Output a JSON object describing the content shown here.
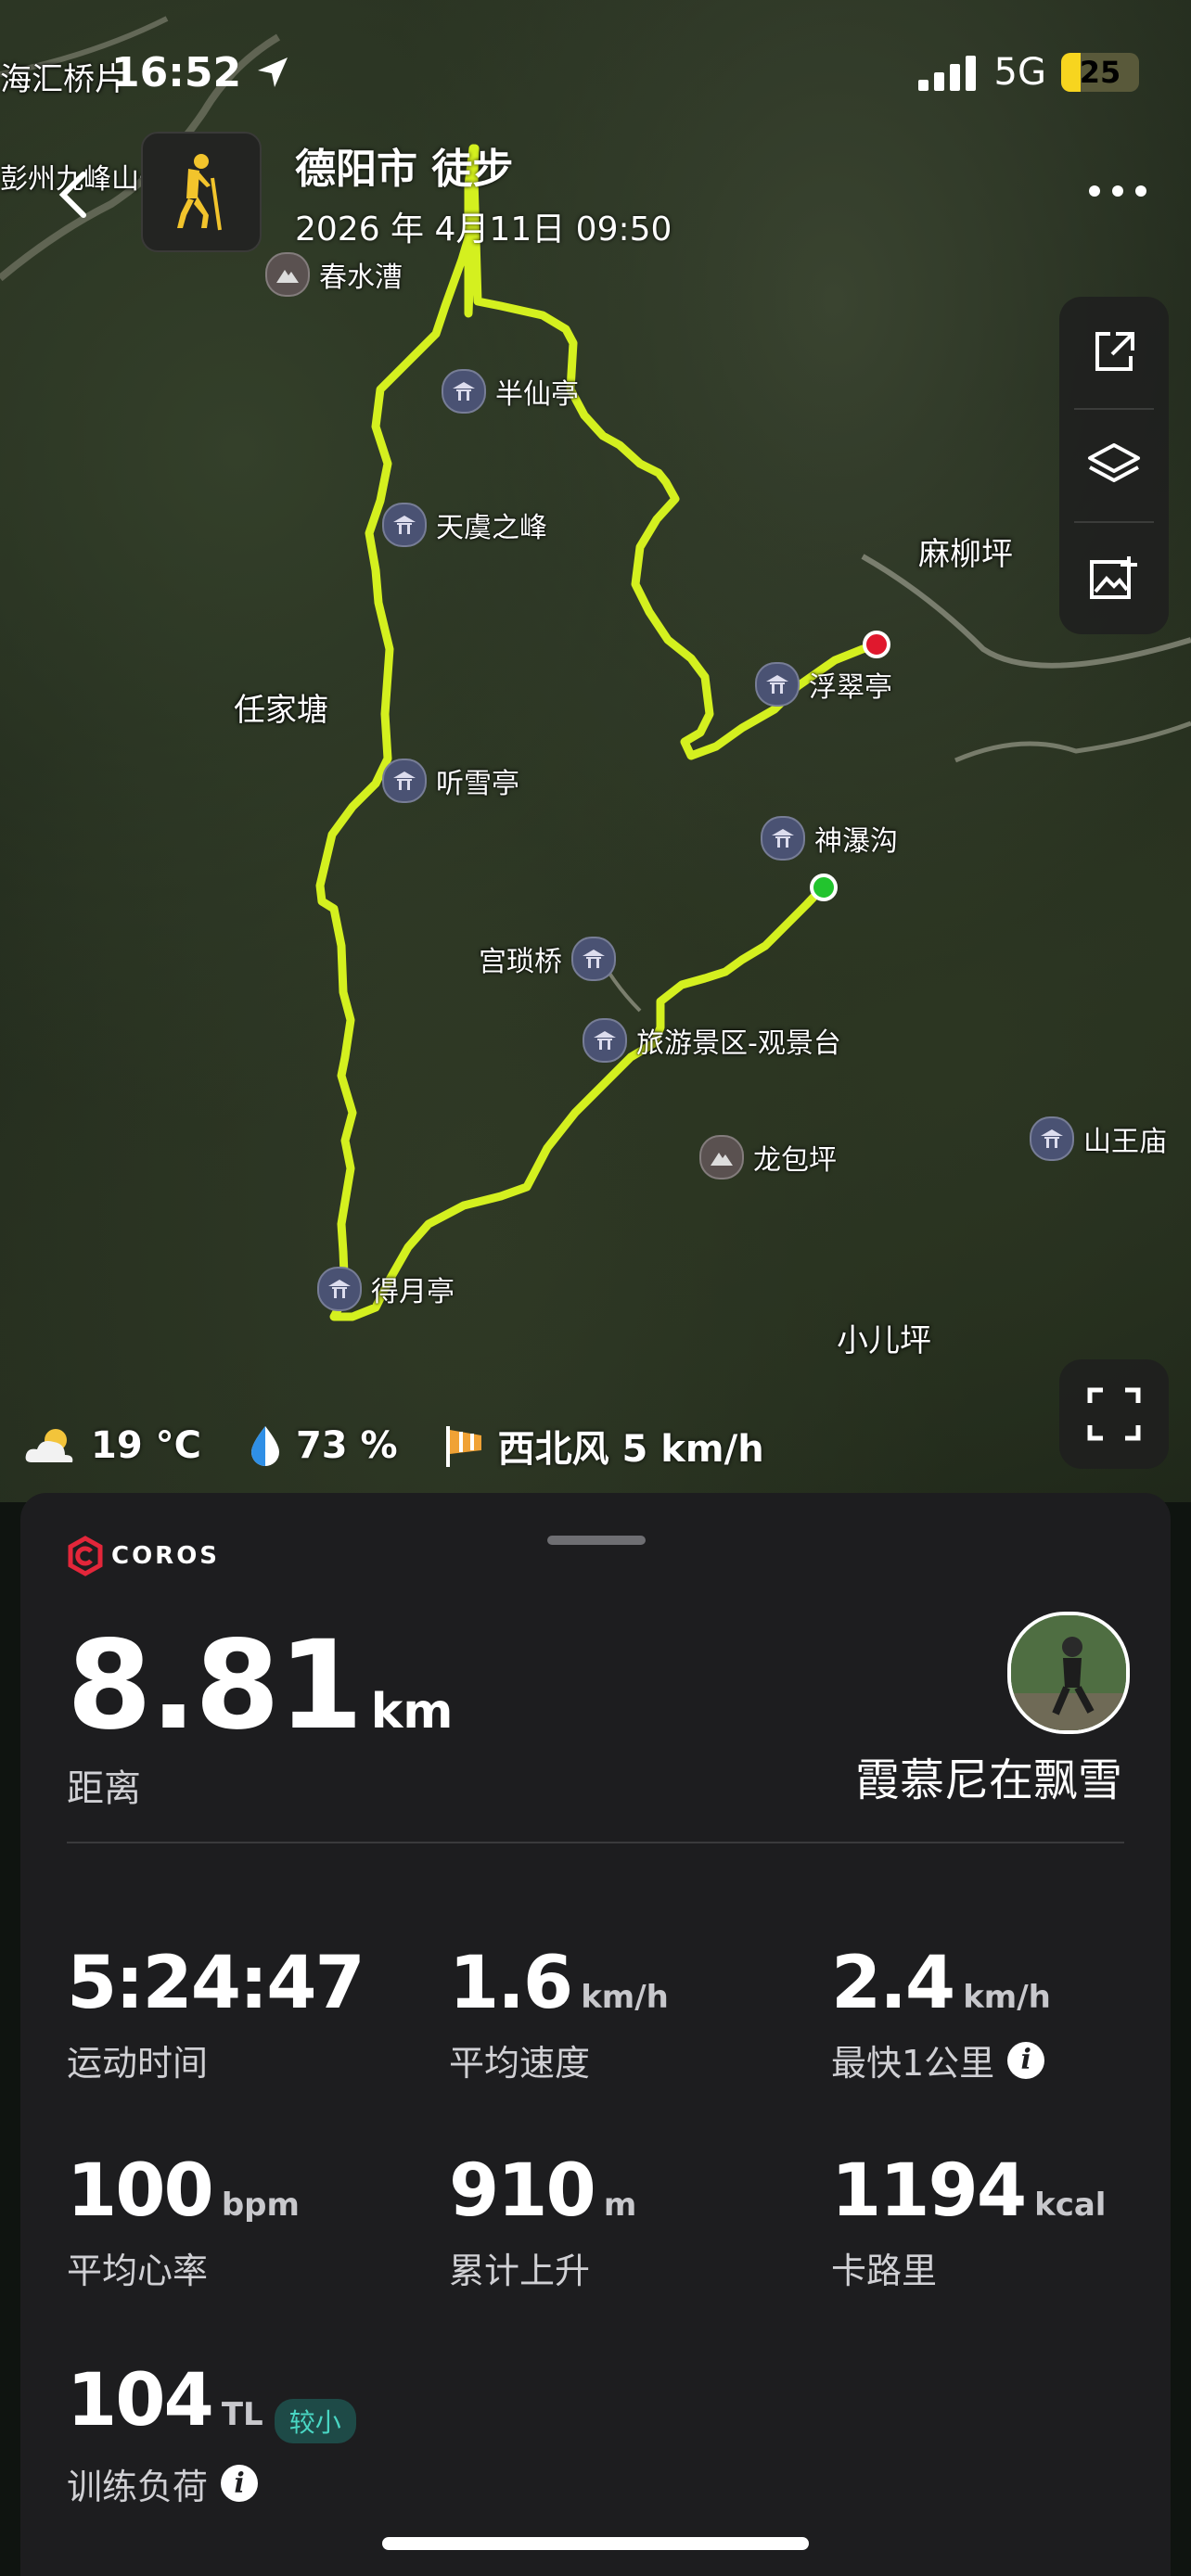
{
  "status_bar": {
    "time": "16:52",
    "network": "5G",
    "battery": "25"
  },
  "header": {
    "title": "德阳市 徒步",
    "datetime": "2026 年 4月11日 09:50",
    "back_icon": "chevron-left-icon",
    "sport_icon": "hiking-icon",
    "more_icon": "more-dots-icon"
  },
  "map": {
    "corner_labels": {
      "top_left_1": "海汇桥片",
      "top_left_2": "彭州九峰山长"
    },
    "places": {
      "renjiatang": "任家塘",
      "maliuping": "麻柳坪",
      "xiaoerping": "小儿坪"
    },
    "pois": {
      "chunshuicao": "春水漕",
      "banxianting": "半仙亭",
      "tianyuzhifeng": "天虞之峰",
      "fucuiting": "浮翠亭",
      "tingxueting": "听雪亭",
      "shenpugou": "神瀑沟",
      "gongxianqiao": "宫琐桥",
      "guanjingtai": "旅游景区-观景台",
      "longbaoping": "龙包坪",
      "shanwangmiao": "山王庙",
      "deyueting": "得月亭"
    },
    "route_color": "#d4f01f",
    "start_color": "#22c42e",
    "end_color": "#e0182d",
    "tools": [
      "share-icon",
      "layers-icon",
      "image-add-icon"
    ],
    "fullscreen_icon": "fullscreen-icon"
  },
  "weather": {
    "temp": "19 °C",
    "humidity": "73 %",
    "wind": "西北风 5 km/h"
  },
  "panel": {
    "brand": "COROS",
    "distance": {
      "value": "8.81",
      "unit": "km",
      "label": "距离"
    },
    "user": {
      "name": "霞慕尼在飘雪"
    },
    "metrics": [
      {
        "value": "5:24:47",
        "unit": "",
        "label": "运动时间"
      },
      {
        "value": "1.6",
        "unit": "km/h",
        "label": "平均速度"
      },
      {
        "value": "2.4",
        "unit": "km/h",
        "label": "最快1公里"
      },
      {
        "value": "100",
        "unit": "bpm",
        "label": "平均心率"
      },
      {
        "value": "910",
        "unit": "m",
        "label": "累计上升"
      },
      {
        "value": "1194",
        "unit": "kcal",
        "label": "卡路里"
      },
      {
        "value": "104",
        "unit": "TL",
        "label": "训练负荷",
        "badge": "较小"
      }
    ]
  }
}
